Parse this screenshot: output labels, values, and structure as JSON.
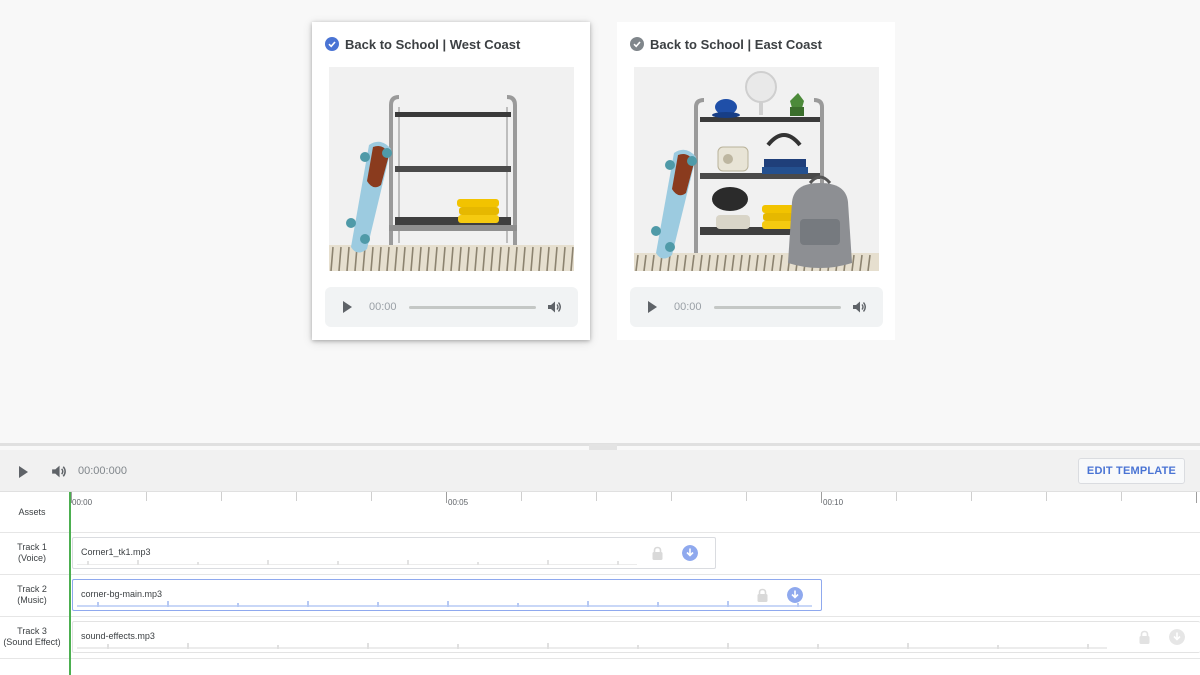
{
  "cards": [
    {
      "title": "Back to School | West Coast",
      "selected": true,
      "check_color": "#4a74d4",
      "player": {
        "time": "00:00"
      }
    },
    {
      "title": "Back to School | East Coast",
      "selected": false,
      "check_color": "#80868b",
      "player": {
        "time": "00:00"
      }
    }
  ],
  "timeline": {
    "current_time": "00:00:000",
    "edit_button": "EDIT TEMPLATE",
    "ruler_labels": [
      "00:00",
      "00:05",
      "00:10"
    ],
    "rows": [
      {
        "label_line1": "Assets",
        "label_line2": ""
      },
      {
        "label_line1": "Track 1",
        "label_line2": "(Voice)",
        "clip": "Corner1_tk1.mp3",
        "selected": false
      },
      {
        "label_line1": "Track 2",
        "label_line2": "(Music)",
        "clip": "corner-bg-main.mp3",
        "selected": true
      },
      {
        "label_line1": "Track 3",
        "label_line2": "(Sound Effect)",
        "clip": "sound-effects.mp3",
        "selected": false
      }
    ]
  },
  "colors": {
    "accent": "#4a74d4",
    "playhead": "#4caf50"
  }
}
